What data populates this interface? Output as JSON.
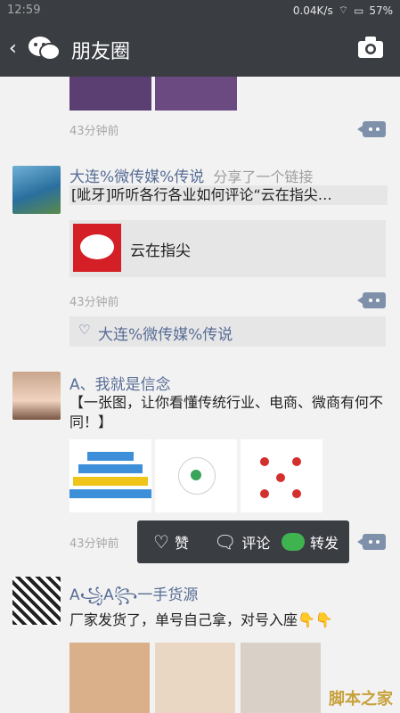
{
  "status": {
    "time": "12:59",
    "speed": "0.04K/s",
    "battery": "57%"
  },
  "header": {
    "title": "朋友圈"
  },
  "posts": [
    {
      "time": "43分钟前"
    },
    {
      "name": "大连%微传媒%传说",
      "meta": "分享了一个链接",
      "text": "[呲牙]听听各行各业如何评论“云在指尖…",
      "link_title": "云在指尖",
      "time": "43分钟前",
      "likes": "大连%微传媒%传说"
    },
    {
      "name": "A、我就是信念",
      "text": "【一张图，让你看懂传统行业、电商、微商有何不同！】",
      "time": "43分钟前"
    },
    {
      "name": "A꧁A꧂一手货源",
      "text": "厂家发货了，单号自己拿，对号入座👇👇"
    }
  ],
  "popup": {
    "like": "赞",
    "comment": "评论",
    "share": "转发"
  },
  "watermark": "脚本之家"
}
